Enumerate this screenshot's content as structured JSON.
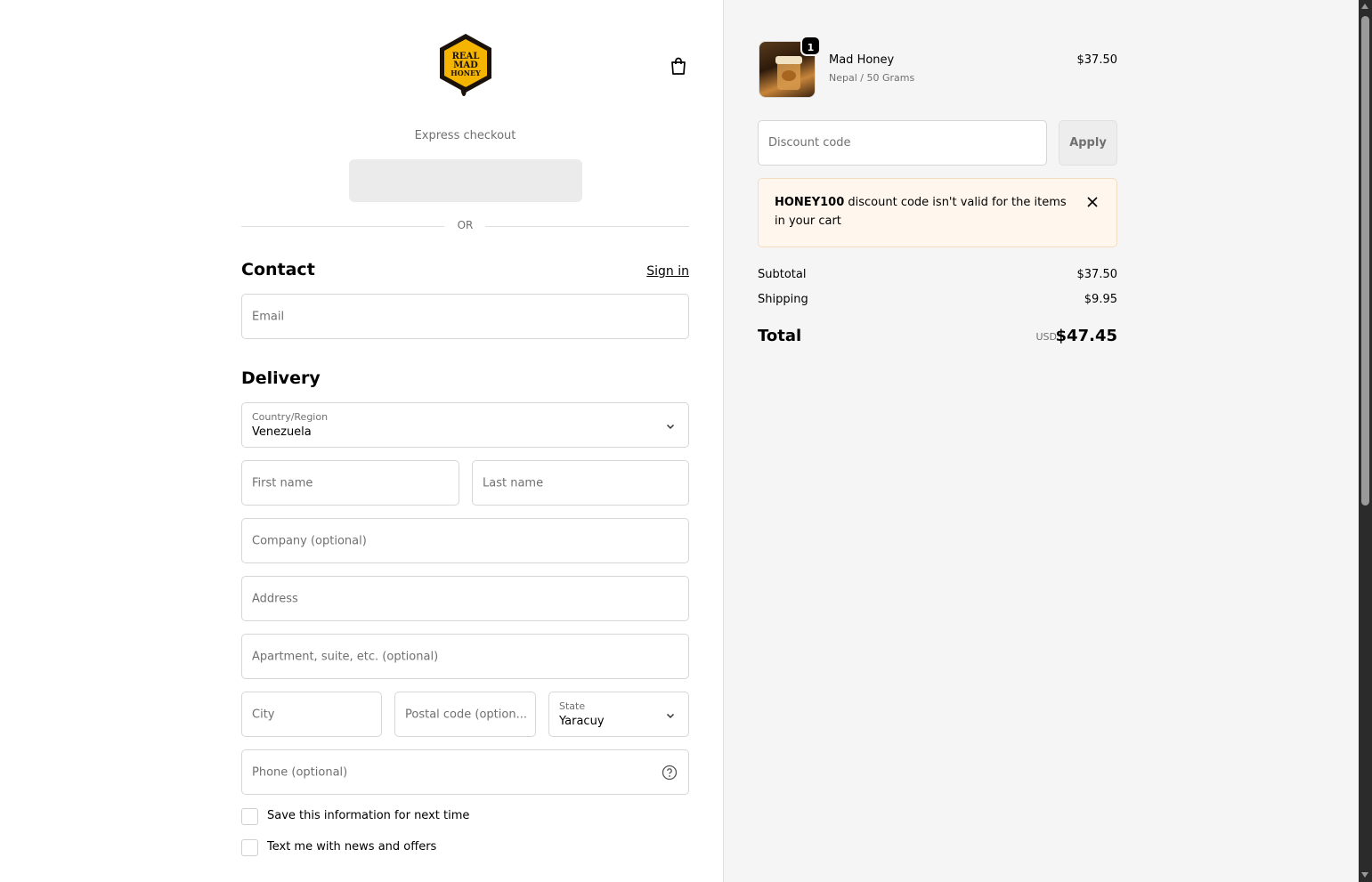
{
  "brand": {
    "logo_lines": [
      "REAL",
      "MAD",
      "HONEY"
    ],
    "logo_colors": {
      "outer": "#1a120a",
      "inner": "#f4b400"
    }
  },
  "header": {
    "cart_icon": "shopping-bag-icon"
  },
  "express": {
    "label": "Express checkout",
    "or_text": "OR"
  },
  "contact": {
    "title": "Contact",
    "sign_in": "Sign in",
    "email_placeholder": "Email"
  },
  "delivery": {
    "title": "Delivery",
    "country_label": "Country/Region",
    "country_value": "Venezuela",
    "first_name_placeholder": "First name",
    "last_name_placeholder": "Last name",
    "company_placeholder": "Company (optional)",
    "address_placeholder": "Address",
    "apartment_placeholder": "Apartment, suite, etc. (optional)",
    "city_placeholder": "City",
    "postal_placeholder": "Postal code (option...",
    "state_label": "State",
    "state_value": "Yaracuy",
    "phone_placeholder": "Phone (optional)",
    "save_info_label": "Save this information for next time",
    "text_me_label": "Text me with news and offers"
  },
  "order": {
    "item": {
      "name": "Mad Honey",
      "variant": "Nepal / 50 Grams",
      "price": "$37.50",
      "quantity": "1"
    },
    "discount_placeholder": "Discount code",
    "apply_label": "Apply",
    "alert": {
      "code": "HONEY100",
      "message": " discount code isn't valid for the items in your cart"
    },
    "subtotal_label": "Subtotal",
    "subtotal_value": "$37.50",
    "shipping_label": "Shipping",
    "shipping_value": "$9.95",
    "total_label": "Total",
    "currency": "USD",
    "total_value": "$47.45"
  },
  "colors": {
    "sidebar_bg": "#f5f5f5",
    "alert_bg": "#fff7ed",
    "express_button_bg": "#ebebeb"
  }
}
